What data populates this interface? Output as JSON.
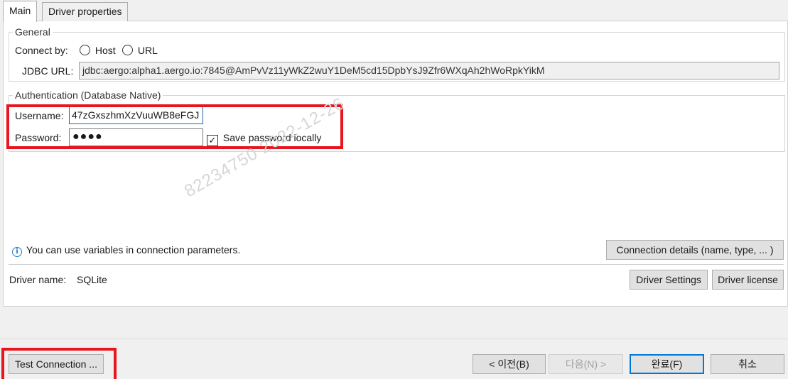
{
  "tabs": {
    "main": "Main",
    "driver_properties": "Driver properties"
  },
  "general": {
    "legend": "General",
    "connect_by_label": "Connect by:",
    "option_host": "Host",
    "option_url": "URL",
    "jdbc_url_label": "JDBC URL:",
    "jdbc_url_value": "jdbc:aergo:alpha1.aergo.io:7845@AmPvVz11yWkZ2wuY1DeM5cd15DpbYsJ9Zfr6WXqAh2hWoRpkYikM"
  },
  "auth": {
    "legend": "Authentication (Database Native)",
    "username_label": "Username:",
    "username_value": "47zGxszhmXzVuuWB8eFGJ",
    "password_label": "Password:",
    "password_value": "●●●●",
    "save_password_label": "Save password locally",
    "save_password_checked": true
  },
  "watermark": "82234750  2022-12-26",
  "info_text": "You can use variables in connection parameters.",
  "connection_details_button": "Connection details (name, type, ... )",
  "driver": {
    "name_label": "Driver name:",
    "name_value": "SQLite",
    "settings_button": "Driver Settings",
    "license_button": "Driver license"
  },
  "footer": {
    "test_connection_button": "Test Connection ...",
    "back_button": "< 이전(B)",
    "next_button": "다음(N) >",
    "finish_button": "완료(F)",
    "cancel_button": "취소"
  },
  "colors": {
    "highlight": "#e8141e",
    "primary_border": "#0078d7"
  }
}
